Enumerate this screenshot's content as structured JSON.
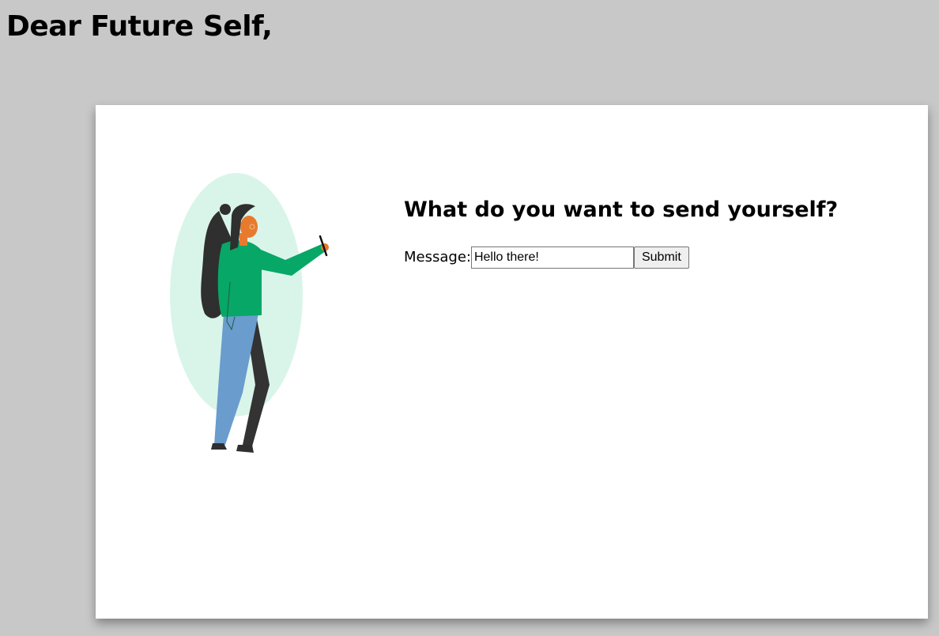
{
  "page": {
    "title": "Dear Future Self,"
  },
  "card": {
    "heading": "What do you want to send yourself?",
    "form": {
      "message_label": "Message:",
      "message_value": "Hello there!",
      "submit_label": "Submit"
    },
    "illustration": {
      "name": "woman-holding-pen-illustration",
      "colors": {
        "backdrop": "#d9f5ea",
        "sweater": "#07a767",
        "skin": "#e87a2e",
        "hair": "#2f2f2f",
        "jeans": "#6a9ccd",
        "back_leg": "#333333"
      }
    }
  }
}
